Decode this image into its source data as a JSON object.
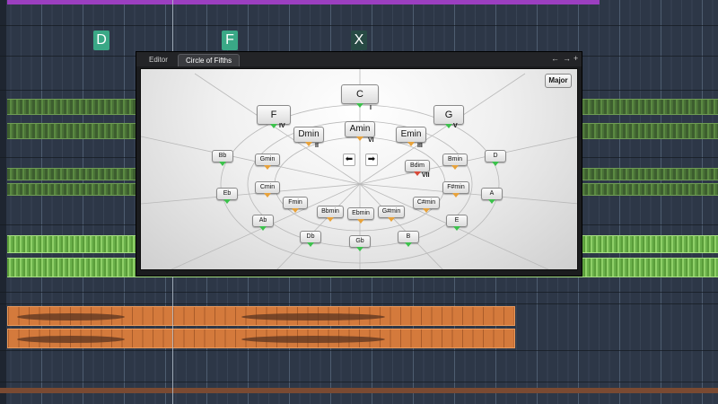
{
  "chord_track": {
    "markers": [
      {
        "label": "D",
        "style": "green"
      },
      {
        "label": "F",
        "style": "green"
      },
      {
        "label": "X",
        "style": "dark"
      }
    ]
  },
  "window": {
    "tabs": [
      {
        "label": "Editor",
        "active": false
      },
      {
        "label": "Circle of Fifths",
        "active": true
      }
    ],
    "controls": [
      "←",
      "→",
      "+"
    ],
    "mode": "Major",
    "nav_left": "⬅",
    "nav_right": "➡",
    "primary": [
      {
        "label": "C",
        "degree": "I"
      },
      {
        "label": "F",
        "degree": "IV"
      },
      {
        "label": "G",
        "degree": "V"
      }
    ],
    "secondary": [
      {
        "label": "Dmin",
        "degree": "II"
      },
      {
        "label": "Amin",
        "degree": "VI"
      },
      {
        "label": "Emin",
        "degree": "III"
      }
    ],
    "diminished": {
      "label": "Bdim",
      "degree": "VII"
    },
    "outer_ring": [
      "Bb",
      "D",
      "Eb",
      "A",
      "Ab",
      "E",
      "Db",
      "Gb",
      "B"
    ],
    "inner_ring": [
      "Gmin",
      "Bmin",
      "Cmin",
      "F#min",
      "Fmin",
      "C#min",
      "Bbmin",
      "Ebmin",
      "G#min"
    ]
  },
  "colors": {
    "accent_green": "#3cc24c",
    "accent_orange": "#e8a23a",
    "accent_red": "#d84a3a",
    "chord_marker": "#3aa886",
    "top_lane": "#9b3fc0",
    "audio_orange": "#d47a3c"
  }
}
